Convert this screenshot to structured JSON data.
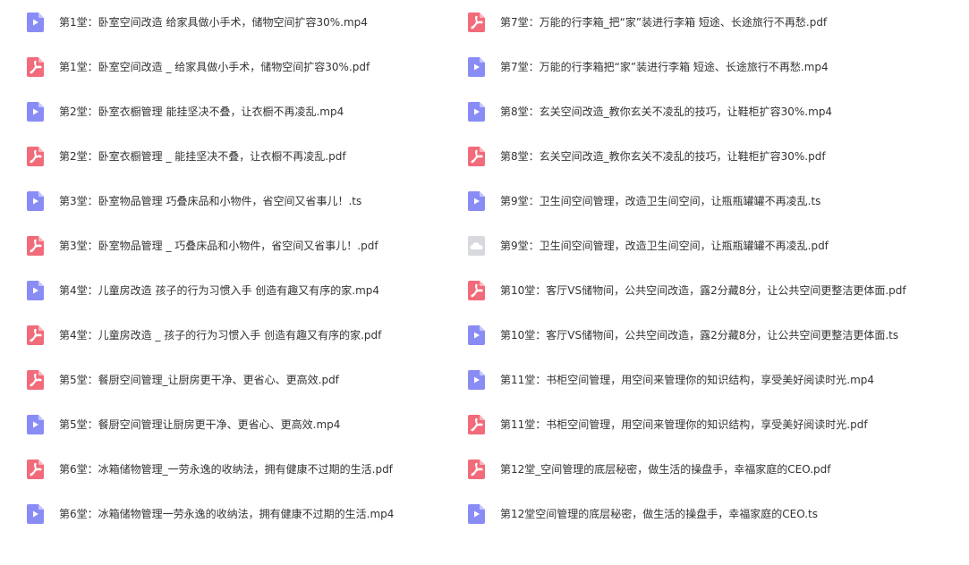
{
  "colors": {
    "video_icon": "#8a8cf5",
    "pdf_icon": "#f26b7a",
    "cloud_icon": "#d7d9de",
    "text": "#333333"
  },
  "files_left": [
    {
      "name": "第1堂：卧室空间改造 给家具做小手术，储物空间扩容30%.mp4",
      "icon": "video-icon"
    },
    {
      "name": "第1堂：卧室空间改造 _ 给家具做小手术，储物空间扩容30%.pdf",
      "icon": "pdf-icon"
    },
    {
      "name": "第2堂：卧室衣橱管理 能挂坚决不叠，让衣橱不再凌乱.mp4",
      "icon": "video-icon"
    },
    {
      "name": "第2堂：卧室衣橱管理 _ 能挂坚决不叠，让衣橱不再凌乱.pdf",
      "icon": "pdf-icon"
    },
    {
      "name": "第3堂：卧室物品管理 巧叠床品和小物件，省空间又省事儿！.ts",
      "icon": "video-icon"
    },
    {
      "name": "第3堂：卧室物品管理 _ 巧叠床品和小物件，省空间又省事儿！.pdf",
      "icon": "pdf-icon"
    },
    {
      "name": "第4堂：儿童房改造 孩子的行为习惯入手 创造有趣又有序的家.mp4",
      "icon": "video-icon"
    },
    {
      "name": "第4堂：儿童房改造 _ 孩子的行为习惯入手 创造有趣又有序的家.pdf",
      "icon": "pdf-icon"
    },
    {
      "name": "第5堂：餐厨空间管理_让厨房更干净、更省心、更高效.pdf",
      "icon": "pdf-icon"
    },
    {
      "name": "第5堂：餐厨空间管理让厨房更干净、更省心、更高效.mp4",
      "icon": "video-icon"
    },
    {
      "name": "第6堂：冰箱储物管理_一劳永逸的收纳法，拥有健康不过期的生活.pdf",
      "icon": "pdf-icon"
    },
    {
      "name": "第6堂：冰箱储物管理一劳永逸的收纳法，拥有健康不过期的生活.mp4",
      "icon": "video-icon"
    }
  ],
  "files_right": [
    {
      "name": "第7堂：万能的行李箱_把“家”装进行李箱 短途、长途旅行不再愁.pdf",
      "icon": "pdf-icon"
    },
    {
      "name": "第7堂：万能的行李箱把“家”装进行李箱 短途、长途旅行不再愁.mp4",
      "icon": "video-icon"
    },
    {
      "name": "第8堂：玄关空间改造_教你玄关不凌乱的技巧，让鞋柜扩容30%.mp4",
      "icon": "video-icon"
    },
    {
      "name": "第8堂：玄关空间改造_教你玄关不凌乱的技巧，让鞋柜扩容30%.pdf",
      "icon": "pdf-icon"
    },
    {
      "name": "第9堂：卫生间空间管理，改造卫生间空间，让瓶瓶罐罐不再凌乱.ts",
      "icon": "video-icon"
    },
    {
      "name": "第9堂：卫生间空间管理，改造卫生间空间，让瓶瓶罐罐不再凌乱.pdf",
      "icon": "cloud-icon"
    },
    {
      "name": "第10堂：客厅VS储物间，公共空间改造，露2分藏8分，让公共空间更整洁更体面.pdf",
      "icon": "pdf-icon"
    },
    {
      "name": "第10堂：客厅VS储物间，公共空间改造，露2分藏8分，让公共空间更整洁更体面.ts",
      "icon": "video-icon"
    },
    {
      "name": "第11堂：书柜空间管理，用空间来管理你的知识结构，享受美好阅读时光.mp4",
      "icon": "video-icon"
    },
    {
      "name": "第11堂：书柜空间管理，用空间来管理你的知识结构，享受美好阅读时光.pdf",
      "icon": "pdf-icon"
    },
    {
      "name": "第12堂_空间管理的底层秘密，做生活的操盘手，幸福家庭的CEO.pdf",
      "icon": "pdf-icon"
    },
    {
      "name": "第12堂空间管理的底层秘密，做生活的操盘手，幸福家庭的CEO.ts",
      "icon": "video-icon"
    }
  ]
}
